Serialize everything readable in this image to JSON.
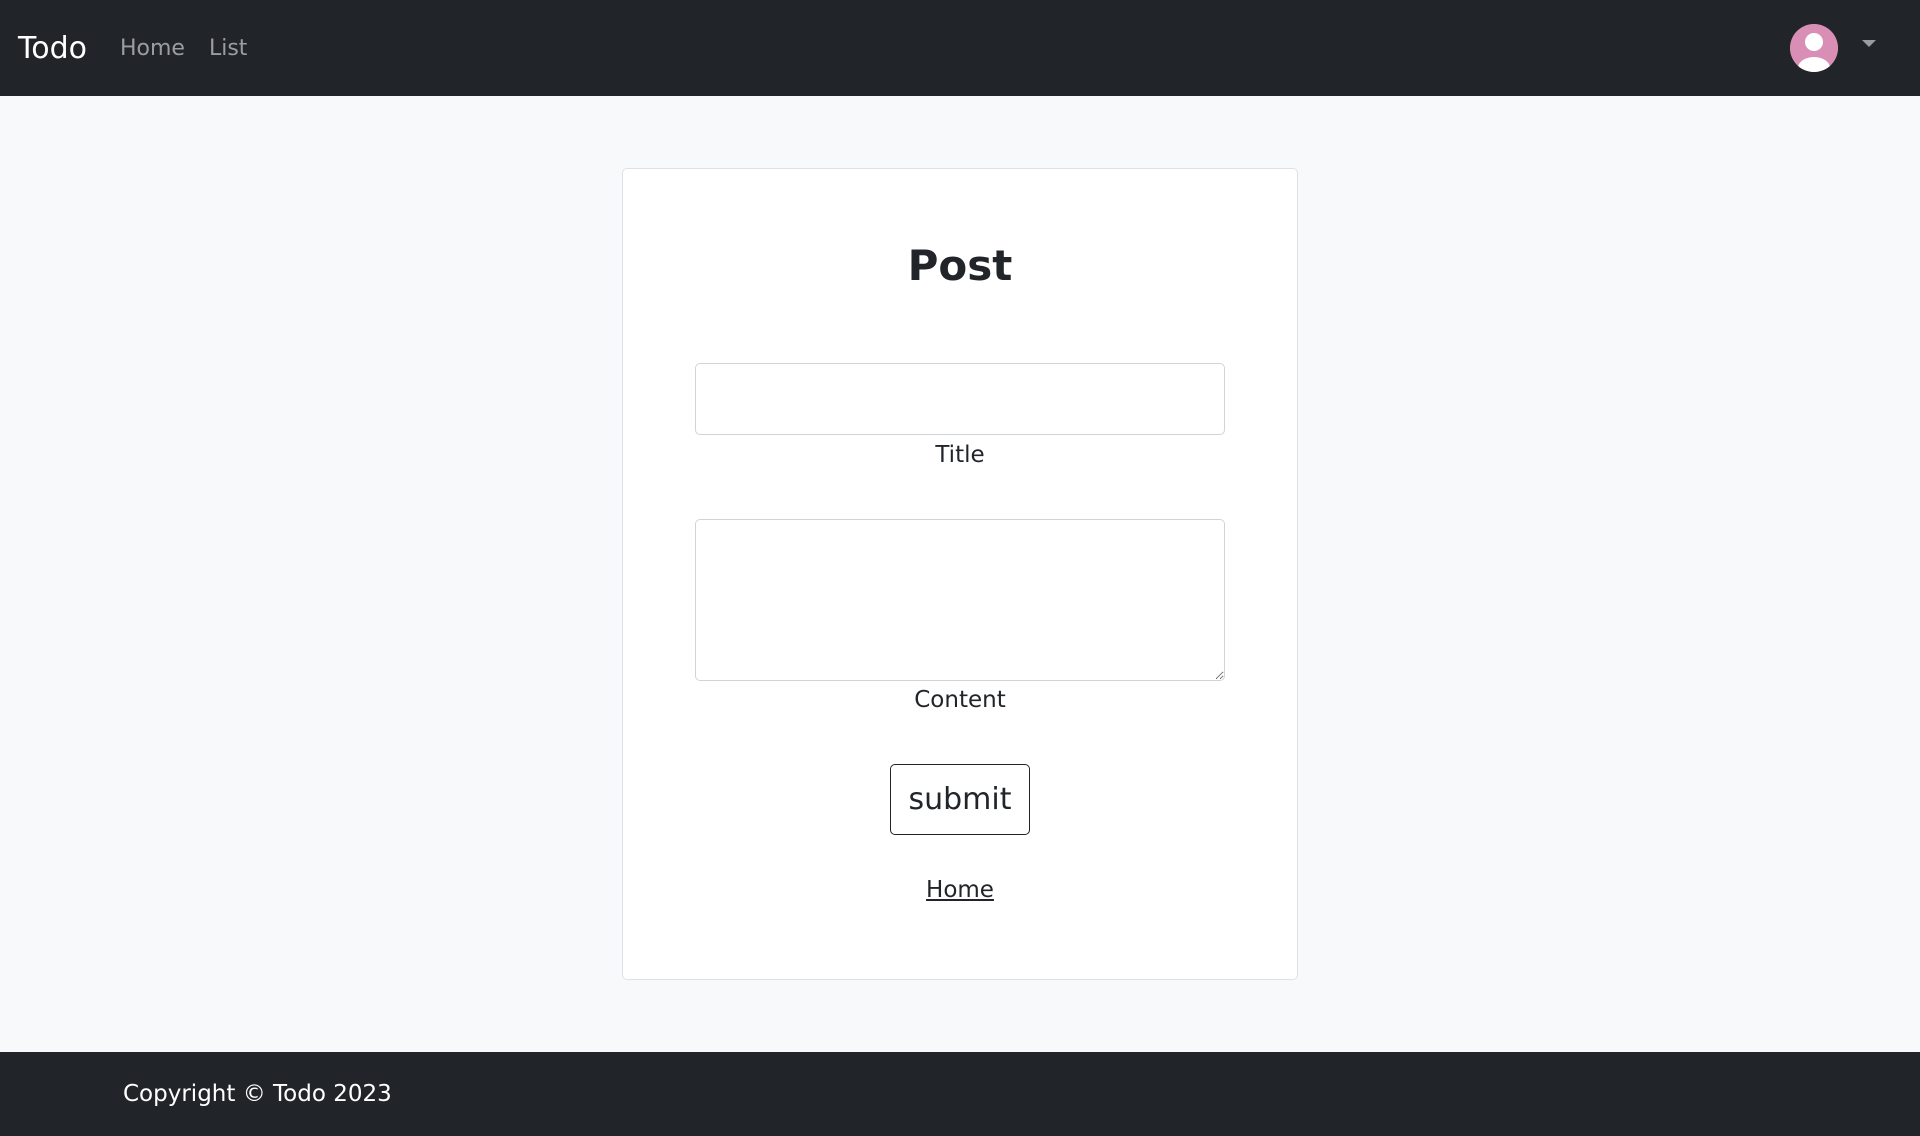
{
  "navbar": {
    "brand": "Todo",
    "links": [
      {
        "label": "Home"
      },
      {
        "label": "List"
      }
    ],
    "avatar_icon": "user-avatar-icon",
    "dropdown_icon": "caret-down-icon"
  },
  "form": {
    "title": "Post",
    "fields": {
      "title_label": "Title",
      "title_value": "",
      "content_label": "Content",
      "content_value": ""
    },
    "submit_label": "submit",
    "home_link": "Home"
  },
  "footer": {
    "text": "Copyright © Todo 2023"
  },
  "colors": {
    "navbar_bg": "#212529",
    "page_bg": "#f8f9fa",
    "avatar": "#d98fb5"
  }
}
